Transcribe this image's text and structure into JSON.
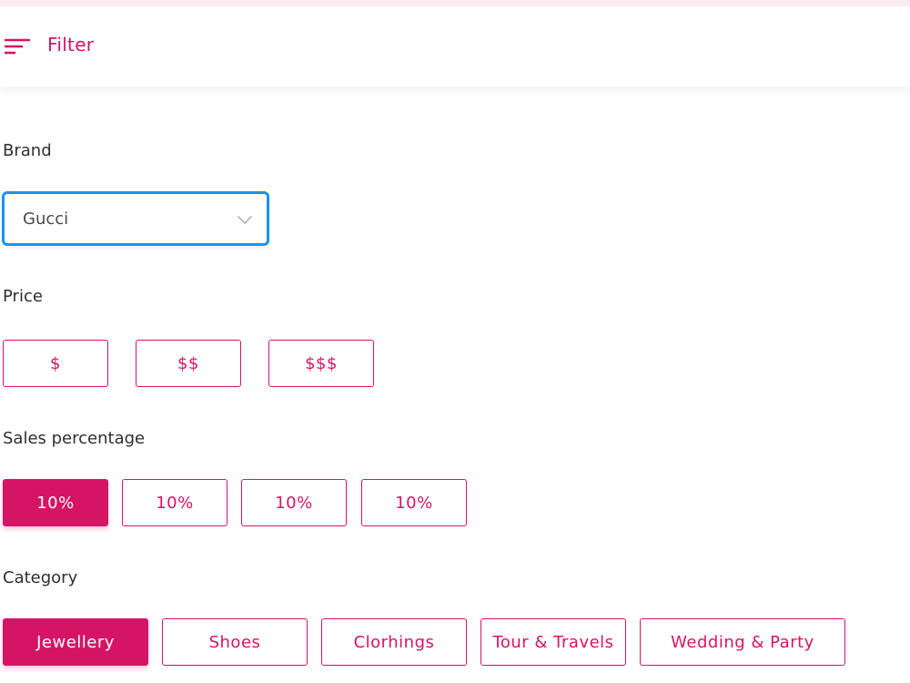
{
  "header": {
    "title": "Filter",
    "icon": "filter-lines-icon",
    "accent": "#d61466"
  },
  "brand": {
    "label": "Brand",
    "selected": "Gucci",
    "focus_color": "#1a93f0"
  },
  "price": {
    "label": "Price",
    "options": [
      "$",
      "$$",
      "$$$"
    ]
  },
  "sales": {
    "label": "Sales percentage",
    "options": [
      "10%",
      "10%",
      "10%",
      "10%"
    ],
    "selected_index": 0
  },
  "category": {
    "label": "Category",
    "options": [
      "Jewellery",
      "Shoes",
      "Clorhings",
      "Tour & Travels",
      "Wedding & Party"
    ],
    "selected_index": 0
  }
}
